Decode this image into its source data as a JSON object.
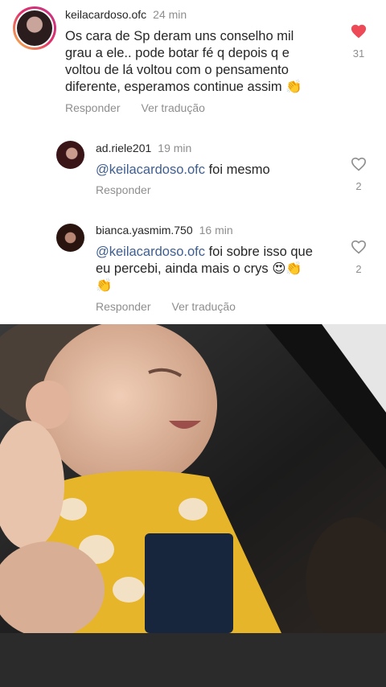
{
  "comments": [
    {
      "username": "keilacardoso.ofc",
      "time": "24 min",
      "lines": [
        "Os cara de Sp deram uns conselho mil",
        "grau a ele.. pode botar fé q depois q e",
        "voltou de lá voltou com o pensamento",
        "diferente, esperamos continue assim 👏"
      ],
      "reply_label": "Responder",
      "translate_label": "Ver tradução",
      "like_count": "31",
      "liked": true
    },
    {
      "username": "ad.riele201",
      "time": "19 min",
      "mention": "@keilacardoso.ofc",
      "text": " foi mesmo",
      "reply_label": "Responder",
      "like_count": "2",
      "liked": false
    },
    {
      "username": "bianca.yasmim.750",
      "time": "16 min",
      "mention": "@keilacardoso.ofc",
      "text": " foi sobre isso que",
      "line2": "eu percebi, ainda mais o crys 😍👏",
      "line3": "👏",
      "reply_label": "Responder",
      "translate_label": "Ver tradução",
      "like_count": "2",
      "liked": false
    }
  ],
  "colors": {
    "liked_heart": "#ed4956",
    "mention": "#3f5e8f",
    "muted": "#8e8e8e"
  },
  "icons": {
    "liked": "heart-filled-icon",
    "unliked": "heart-outline-icon"
  }
}
